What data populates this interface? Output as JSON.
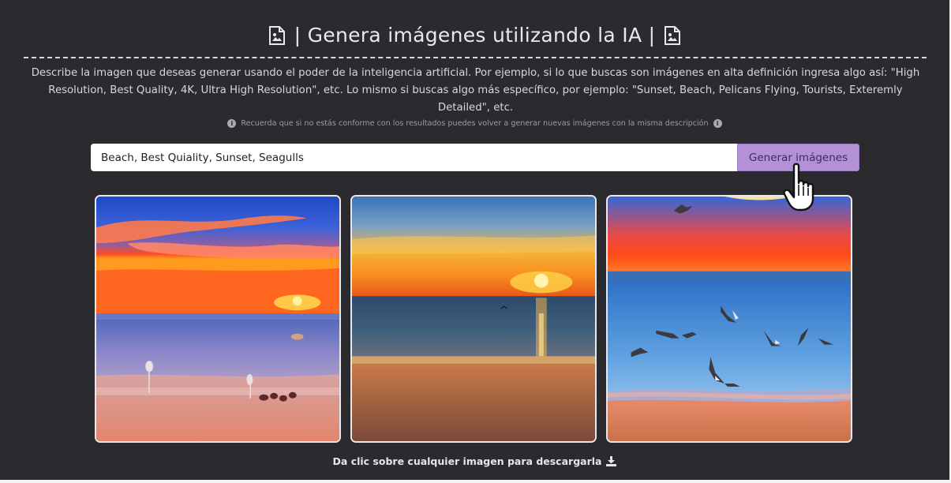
{
  "header": {
    "title": "| Genera imágenes utilizando la IA |",
    "icon": "image-file-icon"
  },
  "description": "Describe la imagen que deseas generar usando el poder de la inteligencia artificial. Por ejemplo, si lo que buscas son imágenes en alta definición ingresa algo así: \"High Resolution, Best Quality, 4K, Ultra High Resolution\", etc. Lo mismo si buscas algo más específico, por ejemplo: \"Sunset, Beach, Pelicans Flying, Tourists, Exteremly Detailed\", etc.",
  "note": "Recuerda que si no estás conforme con los resultados puedes volver a generar nuevas imágenes con la misma descripción",
  "search": {
    "value": "Beach, Best Quiality, Sunset, Seagulls",
    "button_label": "Generar imágenes"
  },
  "images": [
    {
      "name": "generated-image-1"
    },
    {
      "name": "generated-image-2"
    },
    {
      "name": "generated-image-3"
    }
  ],
  "footer": {
    "text": "Da clic sobre cualquier imagen para descargarla",
    "icon": "download-icon"
  },
  "colors": {
    "background": "#2b2b2f",
    "button": "#b291d6",
    "text": "#e9e9ec"
  }
}
